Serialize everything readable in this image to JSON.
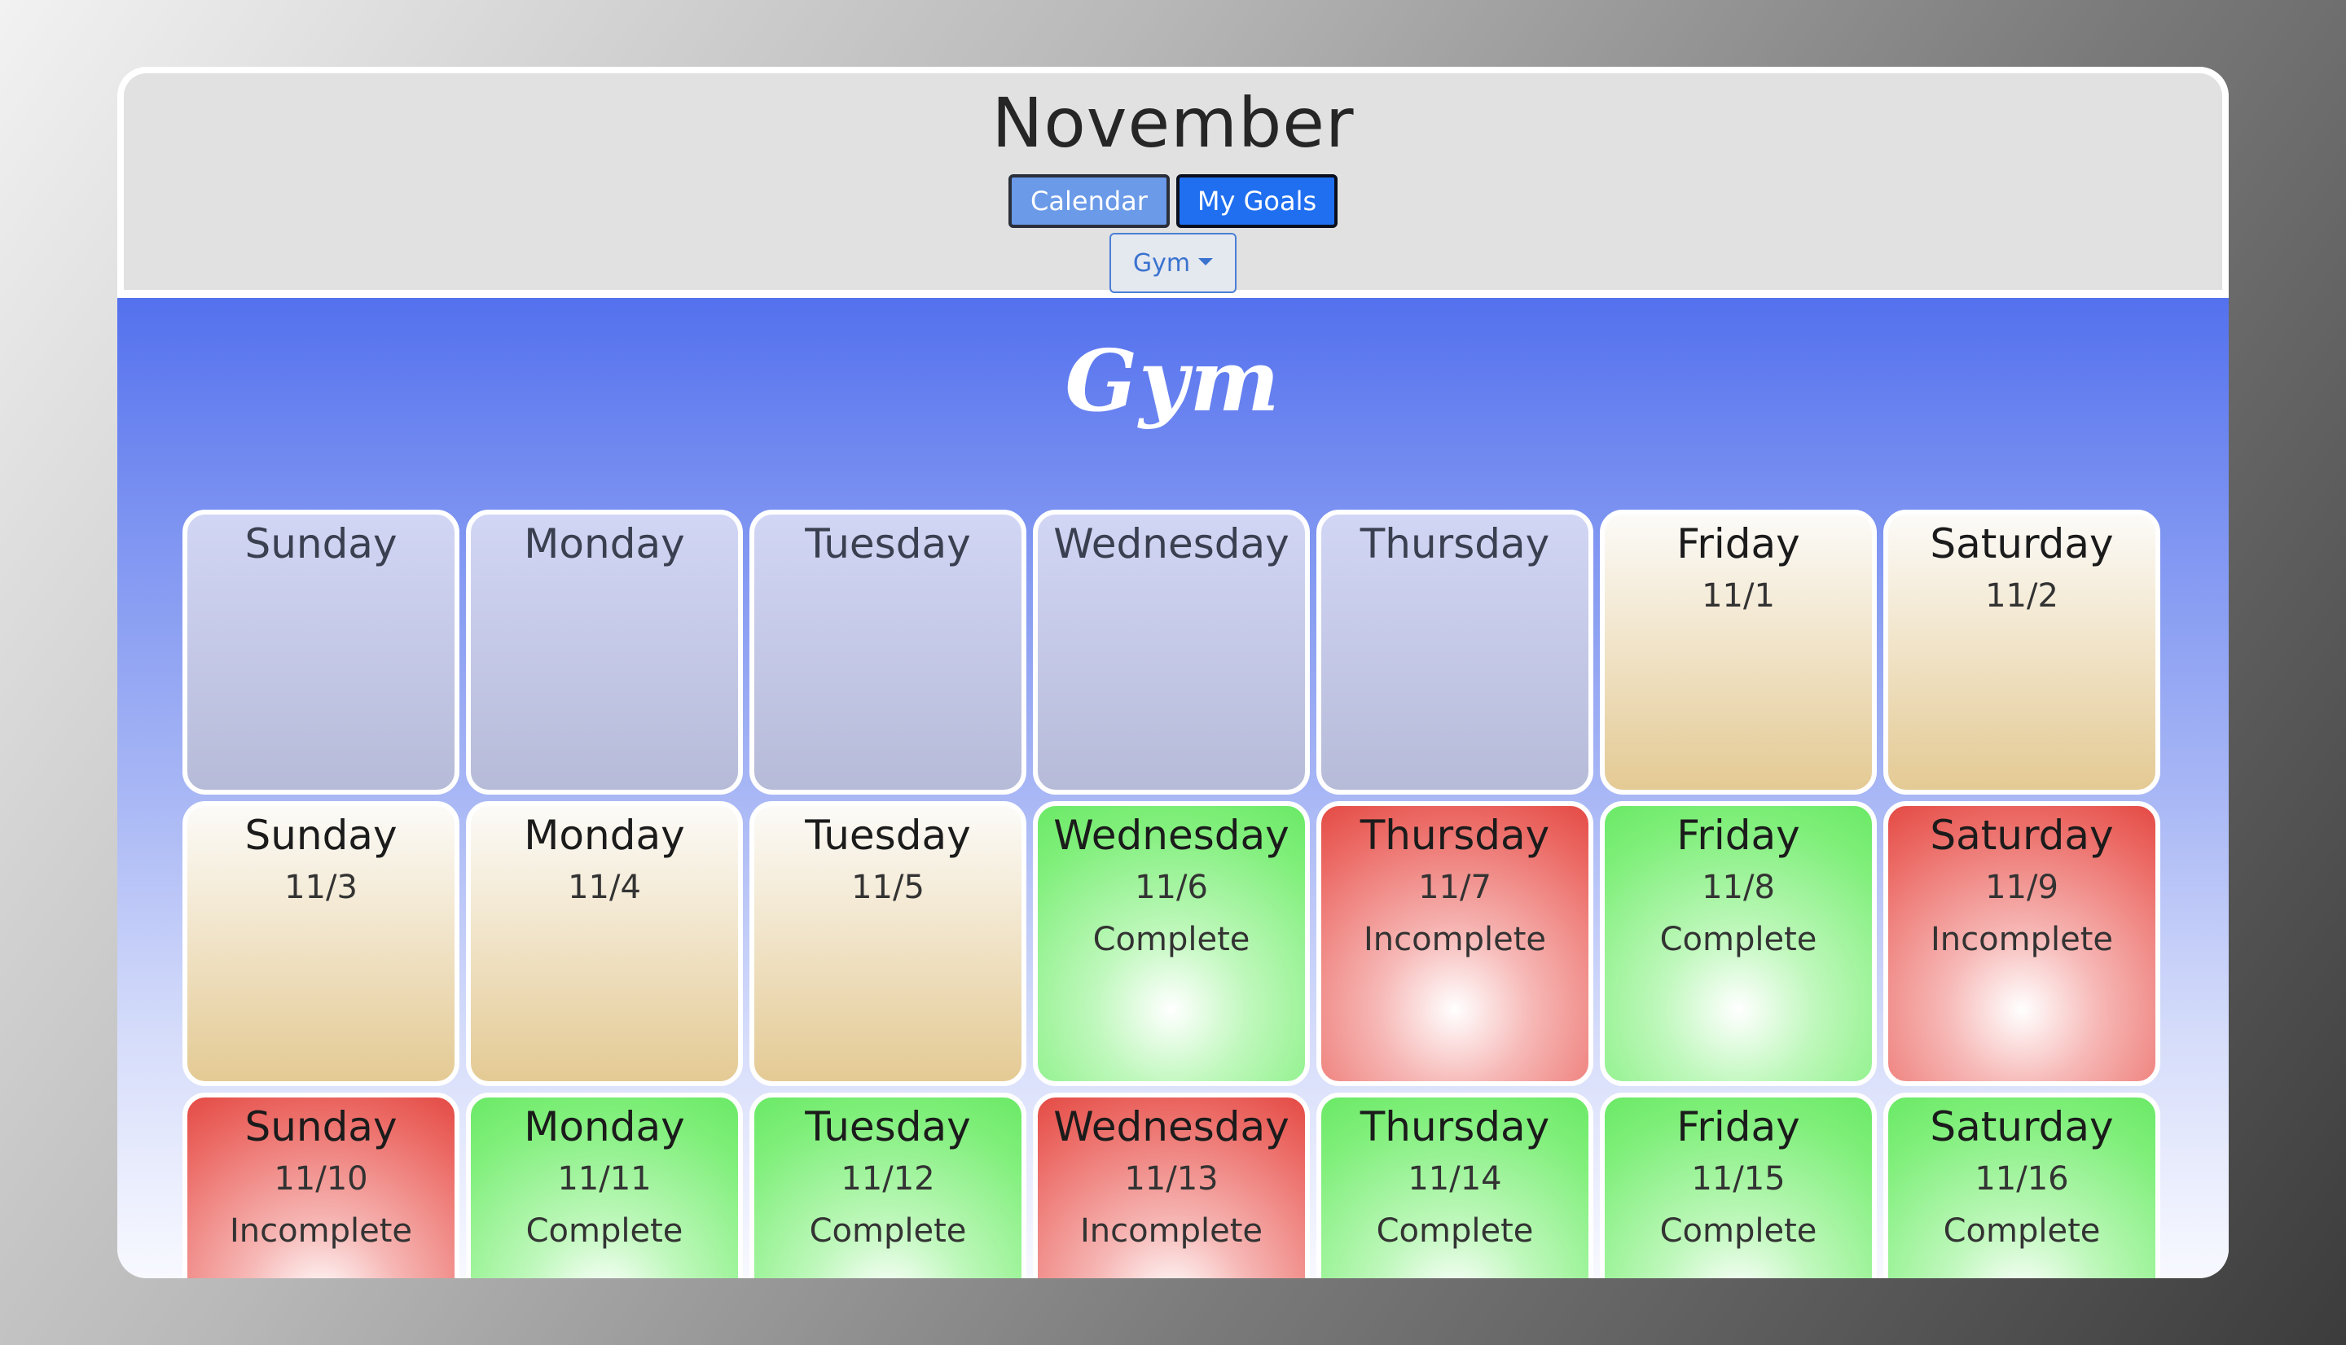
{
  "header": {
    "month": "November",
    "nav": {
      "calendar_label": "Calendar",
      "goals_label": "My Goals"
    },
    "goal_select": {
      "selected": "Gym"
    }
  },
  "goal": {
    "title": "Gym"
  },
  "colors": {
    "complete": "#7fef7a",
    "incomplete": "#ec6b66",
    "future": "#e4ca94",
    "empty": "#b6bbd8",
    "calendar_button": "#6a9ae8",
    "goals_button": "#1f6ff0"
  },
  "calendar": {
    "weeks": [
      [
        {
          "day": "Sunday",
          "date": "",
          "status": "",
          "state": "empty"
        },
        {
          "day": "Monday",
          "date": "",
          "status": "",
          "state": "empty"
        },
        {
          "day": "Tuesday",
          "date": "",
          "status": "",
          "state": "empty"
        },
        {
          "day": "Wednesday",
          "date": "",
          "status": "",
          "state": "empty"
        },
        {
          "day": "Thursday",
          "date": "",
          "status": "",
          "state": "empty"
        },
        {
          "day": "Friday",
          "date": "11/1",
          "status": "",
          "state": "future"
        },
        {
          "day": "Saturday",
          "date": "11/2",
          "status": "",
          "state": "future"
        }
      ],
      [
        {
          "day": "Sunday",
          "date": "11/3",
          "status": "",
          "state": "future"
        },
        {
          "day": "Monday",
          "date": "11/4",
          "status": "",
          "state": "future"
        },
        {
          "day": "Tuesday",
          "date": "11/5",
          "status": "",
          "state": "future"
        },
        {
          "day": "Wednesday",
          "date": "11/6",
          "status": "Complete",
          "state": "complete"
        },
        {
          "day": "Thursday",
          "date": "11/7",
          "status": "Incomplete",
          "state": "incomplete"
        },
        {
          "day": "Friday",
          "date": "11/8",
          "status": "Complete",
          "state": "complete"
        },
        {
          "day": "Saturday",
          "date": "11/9",
          "status": "Incomplete",
          "state": "incomplete"
        }
      ],
      [
        {
          "day": "Sunday",
          "date": "11/10",
          "status": "Incomplete",
          "state": "incomplete"
        },
        {
          "day": "Monday",
          "date": "11/11",
          "status": "Complete",
          "state": "complete"
        },
        {
          "day": "Tuesday",
          "date": "11/12",
          "status": "Complete",
          "state": "complete"
        },
        {
          "day": "Wednesday",
          "date": "11/13",
          "status": "Incomplete",
          "state": "incomplete"
        },
        {
          "day": "Thursday",
          "date": "11/14",
          "status": "Complete",
          "state": "complete"
        },
        {
          "day": "Friday",
          "date": "11/15",
          "status": "Complete",
          "state": "complete"
        },
        {
          "day": "Saturday",
          "date": "11/16",
          "status": "Complete",
          "state": "complete"
        }
      ]
    ]
  }
}
